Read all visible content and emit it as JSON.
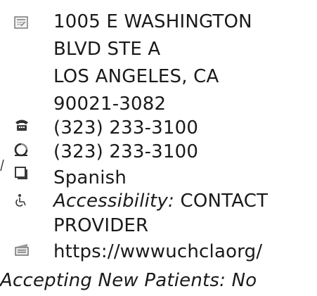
{
  "provider_details": {
    "address": {
      "line1": "1005 E WASHINGTON",
      "line2": "BLVD STE A",
      "line3": "LOS ANGELES, CA",
      "line4": "90021-3082",
      "icon": "address-card-icon"
    },
    "phone": {
      "value": "(323) 233-3100",
      "icon": "telephone-icon"
    },
    "fax": {
      "value": "(323) 233-3100",
      "icon": "fax-icon"
    },
    "language": {
      "value": "Spanish",
      "icon": "language-icon"
    },
    "accessibility": {
      "label": "Accessibility:",
      "value_line1": "CONTACT",
      "value_line2": "PROVIDER",
      "icon": "wheelchair-icon"
    },
    "website": {
      "value": "https://wwwuchclaorg/",
      "icon": "website-icon"
    },
    "accepting_new_patients": {
      "label": "Accepting New Patients:",
      "value": "No"
    }
  }
}
